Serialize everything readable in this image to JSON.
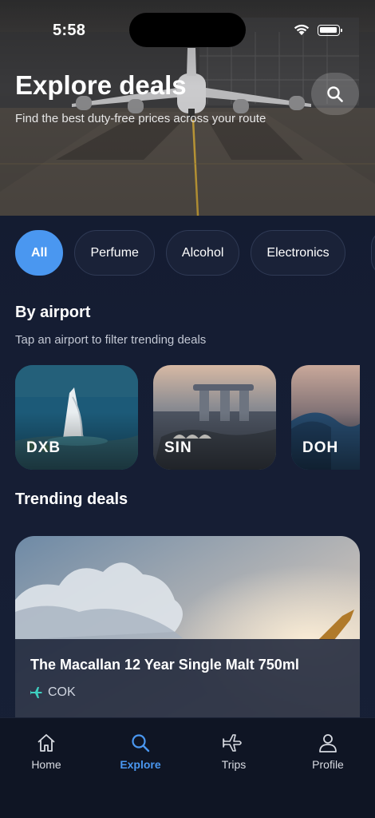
{
  "status_bar": {
    "time": "5:58"
  },
  "hero": {
    "title": "Explore deals",
    "subtitle": "Find the best duty-free prices across your route"
  },
  "categories": [
    {
      "label": "All",
      "active": true
    },
    {
      "label": "Perfume",
      "active": false
    },
    {
      "label": "Alcohol",
      "active": false
    },
    {
      "label": "Electronics",
      "active": false
    }
  ],
  "by_airport": {
    "title": "By airport",
    "subtitle": "Tap an airport to filter trending deals",
    "airports": [
      {
        "code": "DXB"
      },
      {
        "code": "SIN"
      },
      {
        "code": "DOH"
      }
    ]
  },
  "trending": {
    "title": "Trending deals",
    "deals": [
      {
        "name": "The Macallan 12 Year Single Malt 750ml",
        "airport": "COK"
      }
    ]
  },
  "tabbar": {
    "items": [
      {
        "label": "Home",
        "icon": "home-icon"
      },
      {
        "label": "Explore",
        "icon": "search-icon",
        "active": true
      },
      {
        "label": "Trips",
        "icon": "plane-icon"
      },
      {
        "label": "Profile",
        "icon": "person-icon"
      }
    ]
  },
  "colors": {
    "accent": "#4a97f0",
    "background": "#141b2f",
    "plane_badge": "#3ecfc0"
  }
}
